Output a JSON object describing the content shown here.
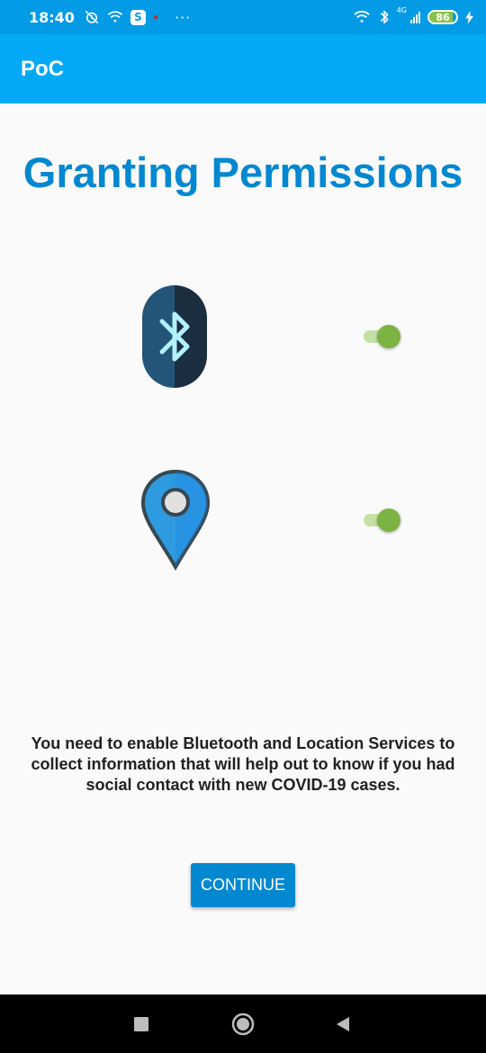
{
  "status_bar": {
    "time": "18:40",
    "left_icons": [
      "alarm-off-icon",
      "wifi-icon",
      "skype-icon",
      "dot-icon",
      "more-icon"
    ],
    "skype_letter": "S",
    "more": "···",
    "network_type": "4G",
    "battery_level": "86",
    "battery_fraction": 0.86,
    "right_icons": [
      "wifi-icon",
      "bluetooth-icon",
      "signal-icon",
      "battery-icon",
      "charging-icon"
    ]
  },
  "app_bar": {
    "title": "PoC",
    "color": "#03a9f4"
  },
  "main": {
    "title": "Granting Permissions",
    "permissions": [
      {
        "icon": "bluetooth-icon",
        "enabled": true
      },
      {
        "icon": "location-pin-icon",
        "enabled": true
      }
    ],
    "description": "You need to enable Bluetooth and Location Services to collect information that will help out to know if you had social contact with new COVID-19 cases.",
    "continue_label": "CONTINUE",
    "accent_color": "#0288d1",
    "switch_on_color": "#7cb342"
  },
  "nav_bar": {
    "buttons": [
      "recent-apps-icon",
      "home-icon",
      "back-icon"
    ]
  }
}
